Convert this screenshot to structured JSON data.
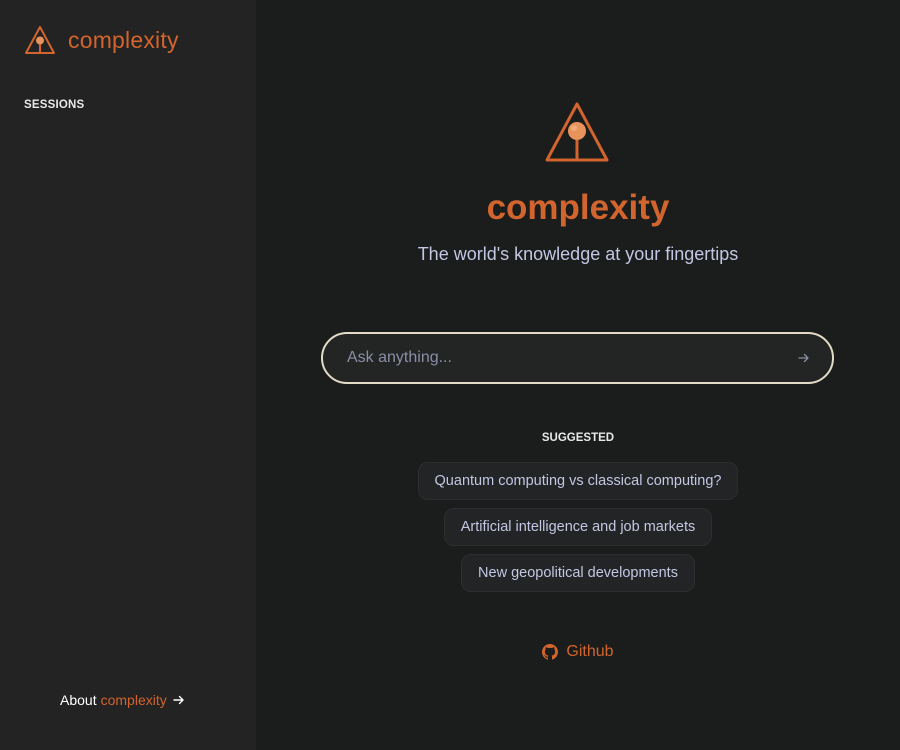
{
  "sidebar": {
    "brand_name": "complexity",
    "sessions_heading": "SESSIONS",
    "about_prefix": "About",
    "about_accent": "complexity"
  },
  "main": {
    "title": "complexity",
    "tagline": "The world's knowledge at your fingertips",
    "search": {
      "placeholder": "Ask anything...",
      "value": ""
    },
    "suggested_heading": "SUGGESTED",
    "suggestions": [
      "Quantum computing vs classical computing?",
      "Artificial intelligence and job markets",
      "New geopolitical developments"
    ],
    "github_label": "Github"
  },
  "icons": {
    "logo": "triangle-pin-logo-icon",
    "send": "arrow-right-icon",
    "about_arrow": "arrow-right-icon",
    "github": "github-icon"
  },
  "colors": {
    "accent": "#d2652e",
    "background": "#1b1c1c",
    "sidebar": "#222322",
    "text": "#c9cde6"
  }
}
